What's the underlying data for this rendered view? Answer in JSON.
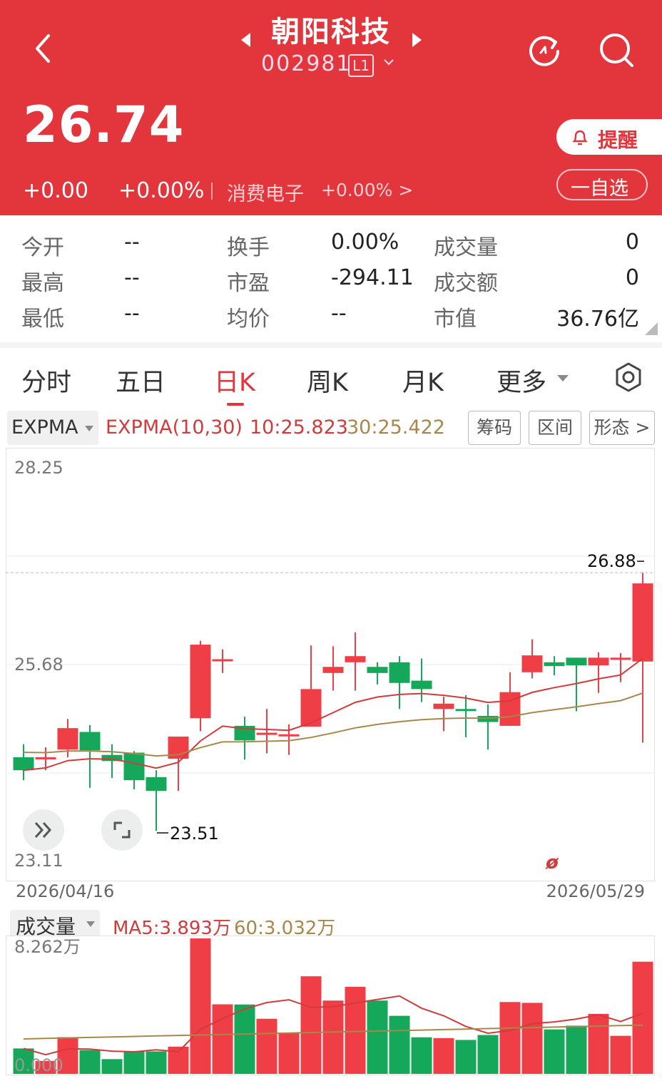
{
  "header": {
    "stock_name": "朝阳科技",
    "stock_code": "002981",
    "level_badge": "L1",
    "price": "26.74",
    "change": "+0.00",
    "change_pct": "+0.00%",
    "sector_name": "消费电子",
    "sector_change": "+0.00% >",
    "remind_label": "提醒",
    "watchlist_label": "一自选",
    "bg_color": "#e2353c"
  },
  "stats": {
    "col1": [
      {
        "label": "今开",
        "value": "--"
      },
      {
        "label": "最高",
        "value": "--"
      },
      {
        "label": "最低",
        "value": "--"
      }
    ],
    "col2": [
      {
        "label": "换手",
        "value": "0.00%"
      },
      {
        "label": "市盈",
        "value": "-294.11"
      },
      {
        "label": "均价",
        "value": "--"
      }
    ],
    "col3": [
      {
        "label": "成交量",
        "value": "0"
      },
      {
        "label": "成交额",
        "value": "0"
      },
      {
        "label": "市值",
        "value": "36.76亿"
      }
    ]
  },
  "tabs": {
    "items": [
      "分时",
      "五日",
      "日K",
      "周K",
      "月K",
      "更多"
    ],
    "active": "日K"
  },
  "indicator": {
    "selector": "EXPMA",
    "label": "EXPMA(10,30)",
    "ma10": "10:25.823",
    "ma30": "30:25.422",
    "buttons": [
      "筹码",
      "区间",
      "形态 >"
    ]
  },
  "chart_data": {
    "type": "candlestick",
    "y_top_label": "28.25",
    "y_mid_label": "25.68",
    "y_bottom_label": "23.11",
    "high_marker": "26.88",
    "low_marker": "23.51",
    "ylim": [
      23.11,
      28.25
    ],
    "start_date": "2026/04/16",
    "end_date": "2026/05/29",
    "candles": [
      {
        "o": 24.47,
        "h": 24.64,
        "l": 24.17,
        "c": 24.3
      },
      {
        "o": 24.47,
        "h": 24.6,
        "l": 24.3,
        "c": 24.47
      },
      {
        "o": 24.57,
        "h": 24.97,
        "l": 24.47,
        "c": 24.85
      },
      {
        "o": 24.8,
        "h": 24.89,
        "l": 24.07,
        "c": 24.56
      },
      {
        "o": 24.5,
        "h": 24.64,
        "l": 24.2,
        "c": 24.42
      },
      {
        "o": 24.53,
        "h": 24.55,
        "l": 24.05,
        "c": 24.17
      },
      {
        "o": 24.21,
        "h": 24.3,
        "l": 23.51,
        "c": 24.03
      },
      {
        "o": 24.45,
        "h": 24.69,
        "l": 24.03,
        "c": 24.74
      },
      {
        "o": 24.98,
        "h": 25.99,
        "l": 24.81,
        "c": 25.94
      },
      {
        "o": 25.75,
        "h": 25.88,
        "l": 25.57,
        "c": 25.75
      },
      {
        "o": 24.88,
        "h": 25.0,
        "l": 24.44,
        "c": 24.69
      },
      {
        "o": 24.79,
        "h": 25.1,
        "l": 24.52,
        "c": 24.79
      },
      {
        "o": 24.75,
        "h": 24.9,
        "l": 24.5,
        "c": 24.77
      },
      {
        "o": 24.87,
        "h": 25.93,
        "l": 24.87,
        "c": 25.36
      },
      {
        "o": 25.57,
        "h": 25.92,
        "l": 25.34,
        "c": 25.65
      },
      {
        "o": 25.71,
        "h": 26.1,
        "l": 25.34,
        "c": 25.79
      },
      {
        "o": 25.65,
        "h": 25.71,
        "l": 25.42,
        "c": 25.57
      },
      {
        "o": 25.71,
        "h": 25.79,
        "l": 25.1,
        "c": 25.44
      },
      {
        "o": 25.47,
        "h": 25.76,
        "l": 25.19,
        "c": 25.36
      },
      {
        "o": 25.1,
        "h": 25.26,
        "l": 24.81,
        "c": 25.17
      },
      {
        "o": 25.1,
        "h": 25.28,
        "l": 24.73,
        "c": 25.08
      },
      {
        "o": 25.01,
        "h": 25.16,
        "l": 24.57,
        "c": 24.93
      },
      {
        "o": 24.88,
        "h": 25.58,
        "l": 24.88,
        "c": 25.32
      },
      {
        "o": 25.58,
        "h": 26.01,
        "l": 25.5,
        "c": 25.8
      },
      {
        "o": 25.71,
        "h": 25.79,
        "l": 25.54,
        "c": 25.66
      },
      {
        "o": 25.77,
        "h": 25.77,
        "l": 25.07,
        "c": 25.67
      },
      {
        "o": 25.67,
        "h": 25.84,
        "l": 25.31,
        "c": 25.77
      },
      {
        "o": 25.77,
        "h": 25.83,
        "l": 25.45,
        "c": 25.77
      },
      {
        "o": 25.72,
        "h": 26.88,
        "l": 24.66,
        "c": 26.74
      }
    ],
    "series": [
      {
        "name": "10",
        "color": "#d23b3b"
      },
      {
        "name": "30",
        "color": "#a7884a"
      }
    ]
  },
  "volume": {
    "selector": "成交量",
    "ma5": "MA5:3.893万",
    "ma60": "60:3.032万",
    "top_label": "8.262万",
    "bottom_label": "0.000",
    "values": [
      1.55,
      0.79,
      2.24,
      1.45,
      0.9,
      1.37,
      1.37,
      1.66,
      8.26,
      4.24,
      4.23,
      3.36,
      2.49,
      5.95,
      4.47,
      5.31,
      4.47,
      3.54,
      2.23,
      2.18,
      2.07,
      2.37,
      4.38,
      4.33,
      2.71,
      2.94,
      3.66,
      2.32,
      6.84
    ]
  },
  "controls": {
    "expand_icon": "double-chevron-icon",
    "fullscreen_icon": "fullscreen-icon"
  }
}
